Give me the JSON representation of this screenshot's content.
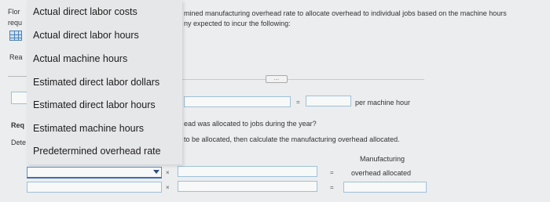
{
  "left_fragments": {
    "line1": "Flor",
    "line2": "requ",
    "line3": "Rea",
    "line4": "Req",
    "line5": "Dete"
  },
  "dropdown": {
    "options": [
      "Actual direct labor costs",
      "Actual direct labor hours",
      "Actual machine hours",
      "Estimated direct labor dollars",
      "Estimated direct labor hours",
      "Estimated machine hours",
      "Predetermined overhead rate"
    ]
  },
  "text": {
    "intro_line1": "mined manufacturing overhead rate to allocate overhead to individual jobs based on the machine hours",
    "intro_line2": "ny expected to incur the following:",
    "expand_button": "....",
    "per_machine_hour": "per machine hour",
    "question1": "ead was allocated to jobs during the year?",
    "question2": "to be allocated, then calculate the manufacturing overhead allocated.",
    "col_header_line1": "Manufacturing",
    "col_header_line2": "overhead allocated",
    "op_multiply": "×",
    "op_equals": "="
  }
}
